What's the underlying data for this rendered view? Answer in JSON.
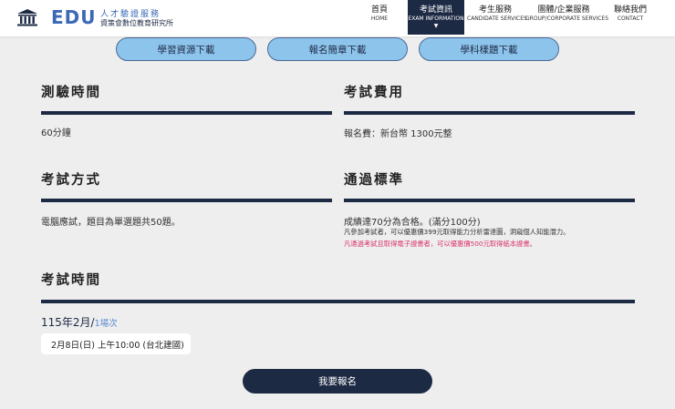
{
  "header": {
    "logo_text": "EDU",
    "logo_tagline": "人才驗證服務",
    "logo_org": "資策會數位教育研究所",
    "nav": [
      {
        "zh": "首頁",
        "en": "HOME"
      },
      {
        "zh": "考試資訊",
        "en": "EXAM INFORMATION"
      },
      {
        "zh": "考生服務",
        "en": "CANDIDATE SERVICES"
      },
      {
        "zh": "團體/企業服務",
        "en": "GROUP/CORPORATE SERVICES"
      },
      {
        "zh": "聯絡我們",
        "en": "CONTACT"
      }
    ]
  },
  "downloads": [
    "學習資源下載",
    "報名簡章下載",
    "學科樣題下載"
  ],
  "sections": {
    "duration": {
      "title": "測驗時間",
      "value": "60分鐘"
    },
    "fee": {
      "title": "考試費用",
      "value": "報名費：新台幣 1300元整"
    },
    "method": {
      "title": "考試方式",
      "value": "電腦應試，題目為單選題共50題。"
    },
    "pass": {
      "title": "通過標準",
      "value": "成績達70分為合格。(滿分100分)",
      "note1": "凡參加考試者，可以優惠價399元取得能力分析雷達圖，洞窺個人知能潛力。",
      "note2": "凡通過考試且取得電子證書者，可以優惠價500元取得紙本證書。"
    },
    "schedule": {
      "title": "考試時間",
      "month": "115年2月/",
      "sessions": "1場次",
      "date": "2月8日(日) 上午10:00 (台北建國)"
    }
  },
  "signup_label": "我要報名",
  "colors": {
    "navy": "#1d2a44",
    "pill": "#8dc4ec",
    "accent_red": "#d9336b",
    "link_blue": "#5b8bd1"
  }
}
